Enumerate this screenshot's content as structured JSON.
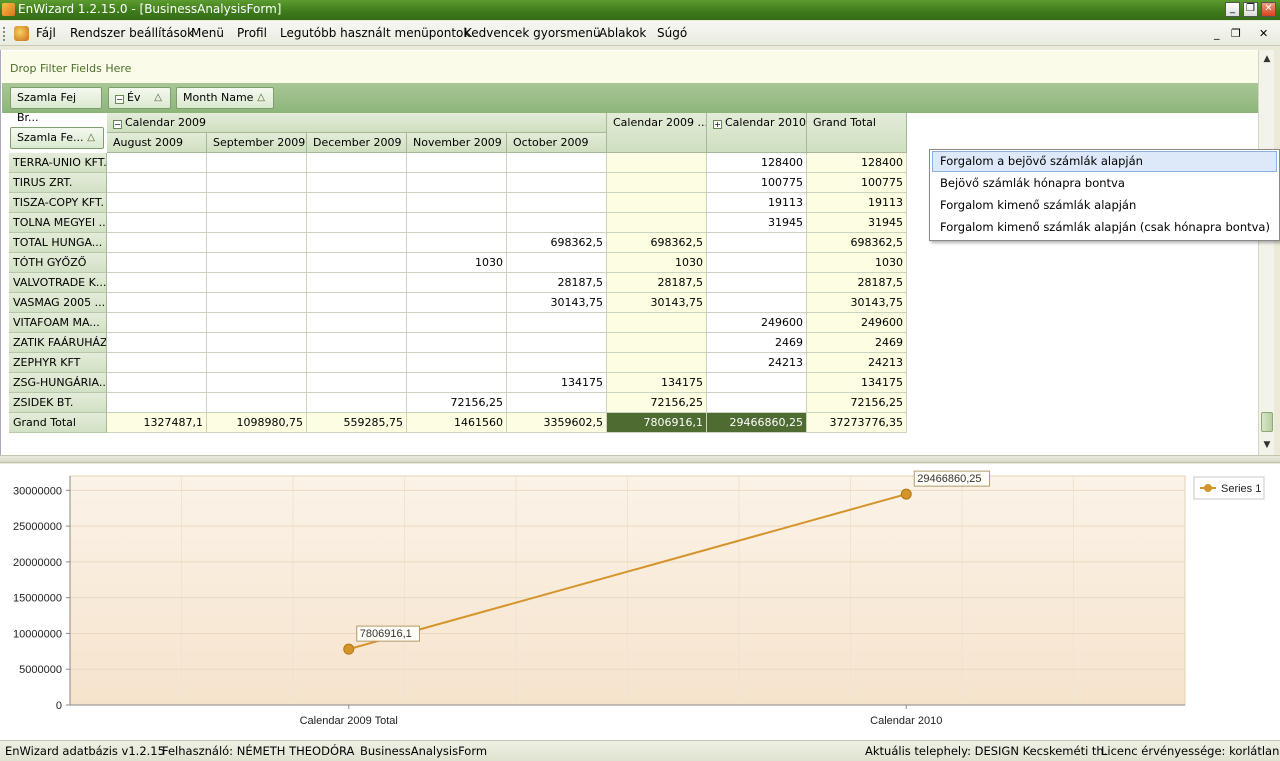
{
  "window": {
    "title": "EnWizard 1.2.15.0 - [BusinessAnalysisForm]",
    "min_glyph": "_",
    "max_glyph": "❐",
    "close_glyph": "✕"
  },
  "menu": {
    "items": [
      "Fájl",
      "Rendszer beállítások",
      "Menü",
      "Profil",
      "Legutóbb használt menüpontok",
      "Kedvencek gyorsmenü",
      "Ablakok",
      "Súgó"
    ],
    "mdi_min": "_",
    "mdi_restore": "❐",
    "mdi_close": "✕"
  },
  "pivot": {
    "filter_placeholder": "Drop Filter Fields Here",
    "column_fields": [
      "Szamla Fej Br...",
      "Év",
      "Month Name"
    ],
    "row_field": "Szamla Fe...",
    "sort_glyph": "△",
    "expand_minus": "−",
    "expand_plus": "+",
    "col_group_2009": "Calendar 2009",
    "months": [
      "August 2009",
      "September 2009",
      "December 2009",
      "November 2009",
      "October 2009"
    ],
    "col_2009_total": "Calendar 2009 ...",
    "col_2010": "Calendar 2010",
    "col_grand_total": "Grand Total",
    "rows": [
      {
        "name": "TERRA-UNIO KFT.",
        "aug": "",
        "sep": "",
        "dec": "",
        "nov": "",
        "oct": "",
        "t2009": "",
        "c2010": "128400",
        "grand": "128400"
      },
      {
        "name": "TIRUS ZRT.",
        "aug": "",
        "sep": "",
        "dec": "",
        "nov": "",
        "oct": "",
        "t2009": "",
        "c2010": "100775",
        "grand": "100775"
      },
      {
        "name": "TISZA-COPY KFT.",
        "aug": "",
        "sep": "",
        "dec": "",
        "nov": "",
        "oct": "",
        "t2009": "",
        "c2010": "19113",
        "grand": "19113"
      },
      {
        "name": "TOLNA MEGYEI ...",
        "aug": "",
        "sep": "",
        "dec": "",
        "nov": "",
        "oct": "",
        "t2009": "",
        "c2010": "31945",
        "grand": "31945"
      },
      {
        "name": "TOTAL HUNGA...",
        "aug": "",
        "sep": "",
        "dec": "",
        "nov": "",
        "oct": "698362,5",
        "t2009": "698362,5",
        "c2010": "",
        "grand": "698362,5"
      },
      {
        "name": "TÓTH GYŐZŐ",
        "aug": "",
        "sep": "",
        "dec": "",
        "nov": "1030",
        "oct": "",
        "t2009": "1030",
        "c2010": "",
        "grand": "1030"
      },
      {
        "name": "VALVOTRADE K...",
        "aug": "",
        "sep": "",
        "dec": "",
        "nov": "",
        "oct": "28187,5",
        "t2009": "28187,5",
        "c2010": "",
        "grand": "28187,5"
      },
      {
        "name": "VASMAG 2005 ...",
        "aug": "",
        "sep": "",
        "dec": "",
        "nov": "",
        "oct": "30143,75",
        "t2009": "30143,75",
        "c2010": "",
        "grand": "30143,75"
      },
      {
        "name": "VITAFOAM MA...",
        "aug": "",
        "sep": "",
        "dec": "",
        "nov": "",
        "oct": "",
        "t2009": "",
        "c2010": "249600",
        "grand": "249600"
      },
      {
        "name": "ZATIK FAÁRUHÁZ",
        "aug": "",
        "sep": "",
        "dec": "",
        "nov": "",
        "oct": "",
        "t2009": "",
        "c2010": "2469",
        "grand": "2469"
      },
      {
        "name": "ZEPHYR KFT",
        "aug": "",
        "sep": "",
        "dec": "",
        "nov": "",
        "oct": "",
        "t2009": "",
        "c2010": "24213",
        "grand": "24213"
      },
      {
        "name": "ZSG-HUNGÁRIA...",
        "aug": "",
        "sep": "",
        "dec": "",
        "nov": "",
        "oct": "134175",
        "t2009": "134175",
        "c2010": "",
        "grand": "134175"
      },
      {
        "name": "ZSIDEK BT.",
        "aug": "",
        "sep": "",
        "dec": "",
        "nov": "72156,25",
        "oct": "",
        "t2009": "72156,25",
        "c2010": "",
        "grand": "72156,25"
      }
    ],
    "grand_total_row": {
      "name": "Grand Total",
      "aug": "1327487,1",
      "sep": "1098980,75",
      "dec": "559285,75",
      "nov": "1461560",
      "oct": "3359602,5",
      "t2009": "7806916,1",
      "c2010": "29466860,25",
      "grand": "37273776,35"
    }
  },
  "context_menu": {
    "items": [
      "Forgalom a bejövő számlák alapján",
      "Bejövő számlák hónapra bontva",
      "Forgalom kimenő számlák alapján",
      "Forgalom kimenő számlák alapján (csak hónapra bontva)"
    ]
  },
  "scroll": {
    "up": "▲",
    "down": "▼"
  },
  "colors": {
    "series": "#d4942a",
    "plot_bg_top": "#fbf3e8",
    "plot_bg_bottom": "#f6e3cc",
    "selected_cell": "#4e6b32"
  },
  "chart_data": {
    "type": "line",
    "categories": [
      "Calendar 2009 Total",
      "Calendar 2010"
    ],
    "series": [
      {
        "name": "Series 1",
        "values": [
          7806916.1,
          29466860.25
        ],
        "labels": [
          "7806916,1",
          "29466860,25"
        ]
      }
    ],
    "yticks": [
      "0",
      "5000000",
      "10000000",
      "15000000",
      "20000000",
      "25000000",
      "30000000"
    ],
    "ylim": [
      0,
      32000000
    ],
    "legend_position": "top-right",
    "grid": true
  },
  "status": {
    "db": "EnWizard adatbázis v1.2.15",
    "user": "Felhasználó: NÉMETH THEODÓRA",
    "form": "BusinessAnalysisForm",
    "site": "Aktuális telephely: DESIGN Kecskeméti th.",
    "license": "Licenc érvényessége: korlátlan"
  }
}
